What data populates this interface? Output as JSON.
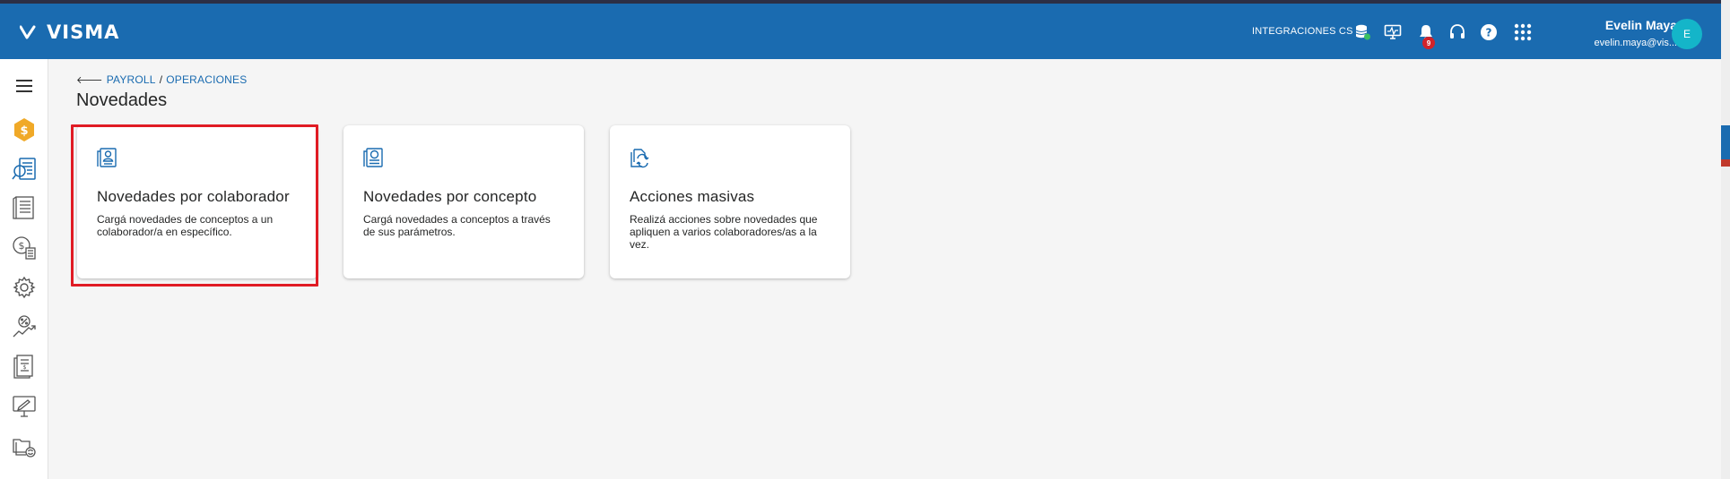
{
  "header": {
    "logo_text": "VISMA",
    "integrations_label": "INTEGRACIONES CS",
    "notification_count": "9",
    "user_name": "Evelin Maya",
    "user_email": "evelin.maya@vis...",
    "avatar_initial": "E",
    "icons": [
      "database-status-icon",
      "monitor-icon",
      "bell-icon",
      "headset-icon",
      "help-icon",
      "apps-grid-icon"
    ]
  },
  "sidebar": {
    "items": [
      "menu-icon",
      "payroll-coin-icon",
      "reports-icon",
      "document-list-icon",
      "money-calculator-icon",
      "settings-icon",
      "percentage-growth-icon",
      "payslip-icon",
      "computer-sign-icon",
      "folders-sync-icon"
    ]
  },
  "breadcrumb": {
    "root": "PAYROLL",
    "separator": "/",
    "current": "OPERACIONES"
  },
  "page": {
    "title": "Novedades"
  },
  "cards": [
    {
      "title": "Novedades por colaborador",
      "description": "Cargá novedades de conceptos a un colaborador/a en específico."
    },
    {
      "title": "Novedades por concepto",
      "description": "Cargá novedades a conceptos a través de sus parámetros."
    },
    {
      "title": "Acciones masivas",
      "description": "Realizá acciones sobre novedades que apliquen a varios colaboradores/as a la vez."
    }
  ],
  "colors": {
    "header_bg": "#1a6bb0",
    "accent_link": "#1a6bb0",
    "avatar_bg": "#14b5c9",
    "badge_bg": "#d2232a",
    "highlight_border": "#e01b24"
  }
}
